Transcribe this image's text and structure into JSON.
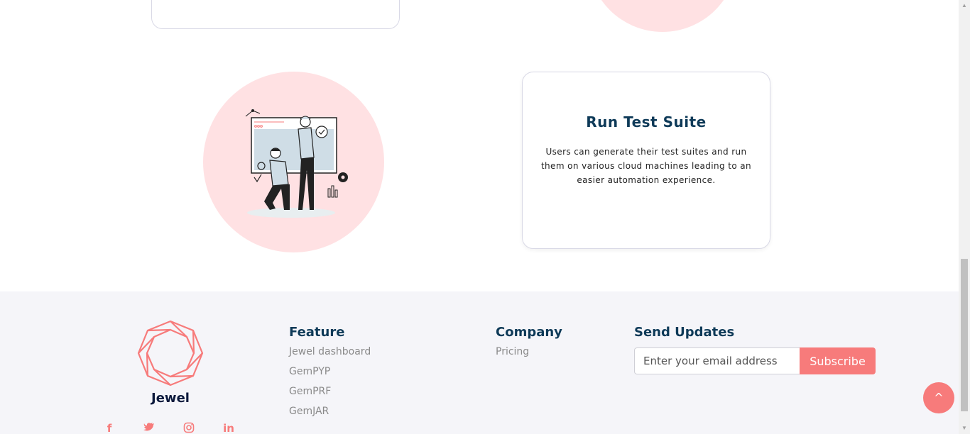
{
  "feature": {
    "title": "Run Test Suite",
    "description": "Users can generate their test suites and run them on various cloud machines leading to an easier automation experience."
  },
  "footer": {
    "brand": "Jewel",
    "feature_heading": "Feature",
    "feature_links": [
      "Jewel dashboard",
      "GemPYP",
      "GemPRF",
      "GemJAR"
    ],
    "company_heading": "Company",
    "company_links": [
      "Pricing"
    ],
    "updates_heading": "Send Updates",
    "email_placeholder": "Enter your email address",
    "subscribe_label": "Subscribe",
    "social_icons": [
      "facebook-icon",
      "twitter-icon",
      "instagram-icon",
      "linkedin-icon"
    ]
  },
  "scroll_top_label": "^",
  "colors": {
    "accent": "#f77b7b",
    "heading": "#0e3a58",
    "circle_bg": "#ffe1e3",
    "footer_bg": "#f5f5f9"
  }
}
